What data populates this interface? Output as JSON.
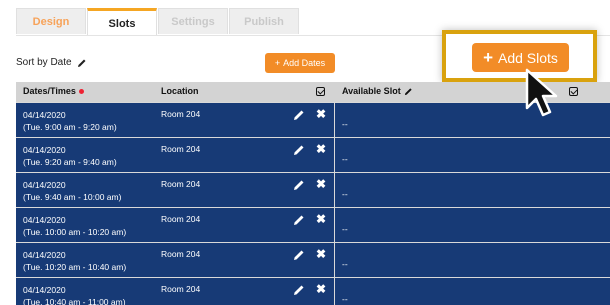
{
  "tabs": [
    {
      "label": "Design"
    },
    {
      "label": "Slots"
    },
    {
      "label": "Settings"
    },
    {
      "label": "Publish"
    }
  ],
  "sort": {
    "label": "Sort by Date"
  },
  "buttons": {
    "add_dates": "Add Dates",
    "add_slots": "Add Slots"
  },
  "table": {
    "headers": {
      "dates_times": "Dates/Times",
      "location": "Location",
      "available_slot": "Available Slot"
    },
    "rows": [
      {
        "date": "04/14/2020",
        "time": "(Tue. 9:00 am - 9:20 am)",
        "location": "Room 204",
        "available": "--"
      },
      {
        "date": "04/14/2020",
        "time": "(Tue. 9:20 am - 9:40 am)",
        "location": "Room 204",
        "available": "--"
      },
      {
        "date": "04/14/2020",
        "time": "(Tue. 9:40 am - 10:00 am)",
        "location": "Room 204",
        "available": "--"
      },
      {
        "date": "04/14/2020",
        "time": "(Tue. 10:00 am - 10:20 am)",
        "location": "Room 204",
        "available": "--"
      },
      {
        "date": "04/14/2020",
        "time": "(Tue. 10:20 am - 10:40 am)",
        "location": "Room 204",
        "available": "--"
      },
      {
        "date": "04/14/2020",
        "time": "(Tue. 10:40 am - 11:00 am)",
        "location": "Room 204",
        "available": "--"
      }
    ]
  },
  "colors": {
    "accent": "#f28c27",
    "table_bg": "#173a76",
    "highlight_border": "#d9a20e"
  }
}
